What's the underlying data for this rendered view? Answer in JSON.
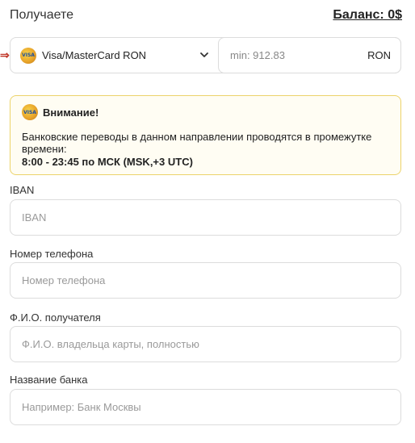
{
  "header": {
    "title": "Получаете",
    "balance": "Баланс: 0$"
  },
  "exchange": {
    "arrow": "⇒",
    "card_logo_text": "VISA",
    "currency_label": "Visa/MasterCard RON",
    "amount_placeholder": "min: 912.83",
    "amount_value": "",
    "amount_unit": "RON"
  },
  "notice": {
    "title": "Внимание!",
    "text": "Банковские переводы в данном направлении проводятся в промежутке времени:",
    "time": "8:00 - 23:45 по МСК (MSK,+3 UTC)",
    "border_color": "#ecd36a"
  },
  "fields": {
    "iban": {
      "label": "IBAN",
      "placeholder": "IBAN"
    },
    "phone": {
      "label": "Номер телефона",
      "placeholder": "Номер телефона"
    },
    "name": {
      "label": "Ф.И.О. получателя",
      "placeholder": "Ф.И.О. владельца карты, полностью"
    },
    "bank": {
      "label": "Название банка",
      "placeholder": "Например: Банк Москвы"
    }
  }
}
